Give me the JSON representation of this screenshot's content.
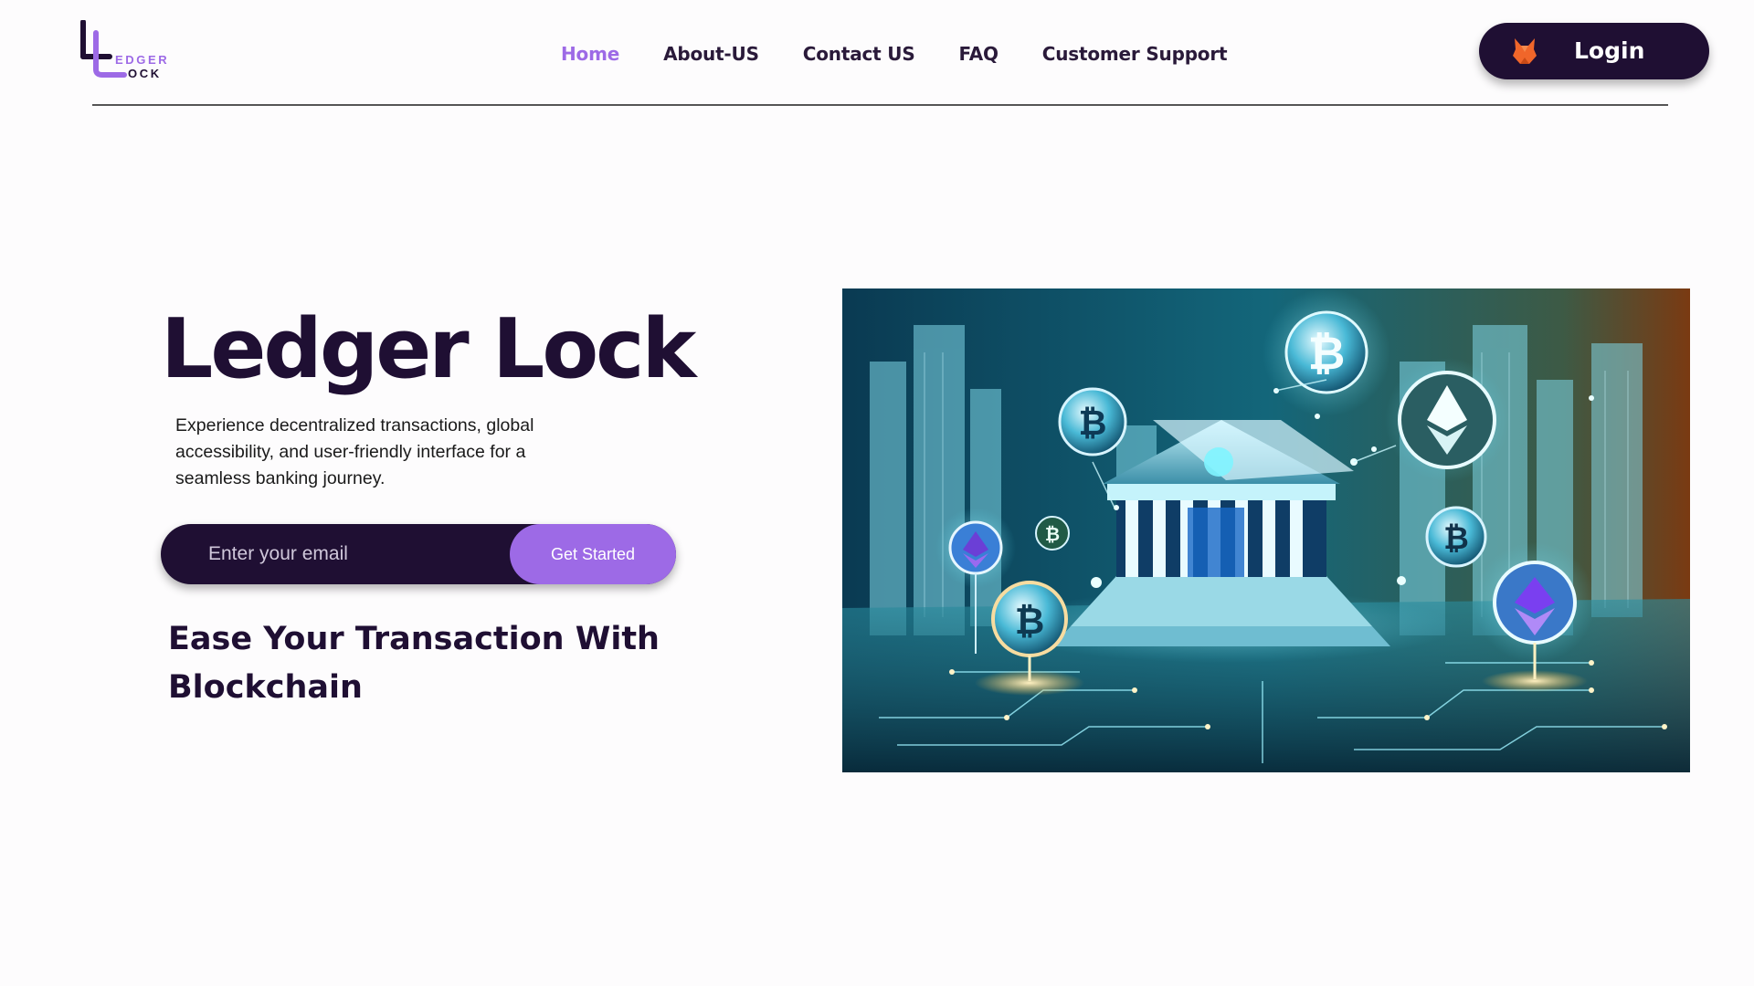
{
  "header": {
    "logo": {
      "line1": "EDGER",
      "line2": "OCK",
      "accent_color": "#9d6ae6"
    },
    "nav": [
      {
        "label": "Home",
        "active": true
      },
      {
        "label": "About-US",
        "active": false
      },
      {
        "label": "Contact US",
        "active": false
      },
      {
        "label": "FAQ",
        "active": false
      },
      {
        "label": "Customer Support",
        "active": false
      }
    ],
    "login": {
      "label": "Login",
      "icon": "fox-icon"
    }
  },
  "hero": {
    "title": "Ledger Lock",
    "description": "Experience decentralized transactions, global accessibility, and user-friendly interface for a seamless banking journey.",
    "email_placeholder": "Enter your email",
    "email_value": "",
    "cta_label": "Get Started",
    "tagline": "Ease Your Transaction With Blockchain"
  },
  "illustration": {
    "subject": "bank building with bitcoin and ethereum coins",
    "icons": [
      "bank-icon",
      "bitcoin-icon",
      "ethereum-icon"
    ]
  },
  "colors": {
    "dark": "#1f0f33",
    "accent": "#9d6ae6",
    "background": "#fdfcfd",
    "fox": "#f0662a"
  }
}
